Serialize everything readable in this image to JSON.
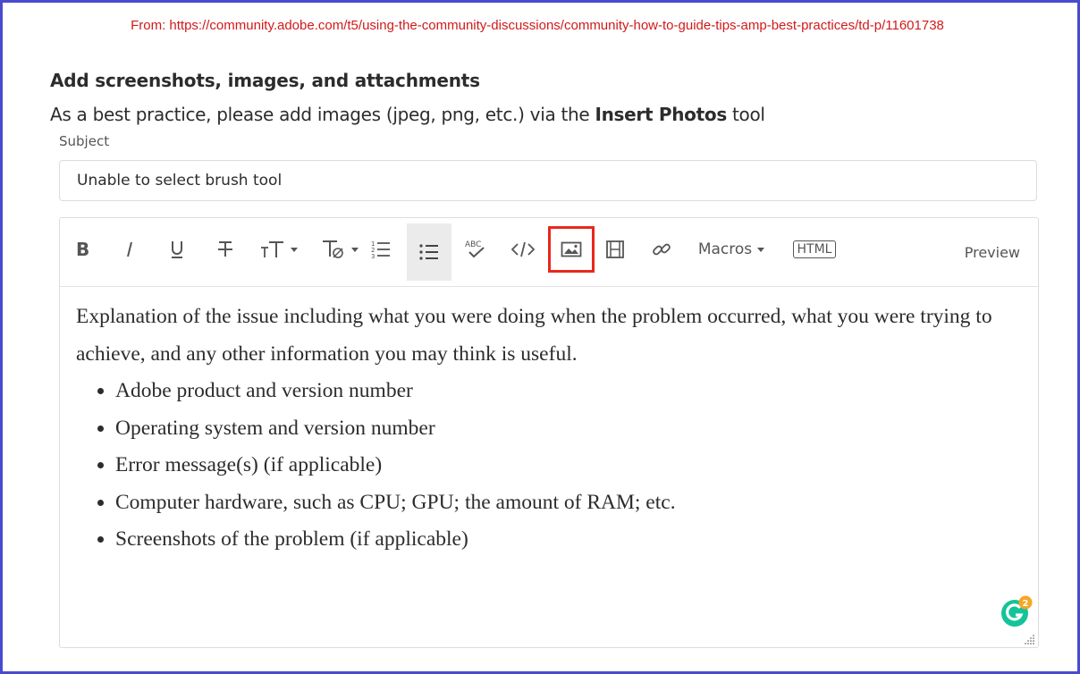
{
  "source": {
    "text": "From: https://community.adobe.com/t5/using-the-community-discussions/community-how-to-guide-tips-amp-best-practices/td-p/11601738"
  },
  "section": {
    "heading": "Add screenshots, images, and attachments",
    "practice_prefix": "As a best practice, please add images (jpeg, png, etc.) via the ",
    "practice_bold": "Insert Photos",
    "practice_suffix": " tool"
  },
  "subject": {
    "label": "Subject",
    "value": "Unable to select brush tool"
  },
  "toolbar": {
    "macros_label": "Macros",
    "html_label": "HTML",
    "preview_label": "Preview",
    "spell_label": "ABC",
    "buttons": [
      "bold",
      "italic",
      "underline",
      "strikethrough",
      "font-size",
      "text-style",
      "numbered-list",
      "bulleted-list",
      "spellcheck",
      "code",
      "insert-photos",
      "insert-video",
      "insert-link"
    ],
    "active_button": "bulleted-list",
    "highlighted_button": "insert-photos",
    "highlight_color": "#e8281a"
  },
  "editor_body": {
    "paragraph": "Explanation of the issue including what you were doing when the problem occurred, what you were trying to achieve, and any other information you may think is useful.",
    "bullets": [
      "Adobe product and version number",
      "Operating system and version number",
      "Error message(s) (if applicable)",
      "Computer hardware, such as CPU; GPU; the amount of RAM; etc.",
      "Screenshots of the problem (if applicable)"
    ]
  },
  "grammarly": {
    "badge_count": "2",
    "color": "#15c39a",
    "badge_color": "#f5a623"
  },
  "colors": {
    "frame": "#4a4ad0",
    "source_text": "#d11a1a"
  }
}
